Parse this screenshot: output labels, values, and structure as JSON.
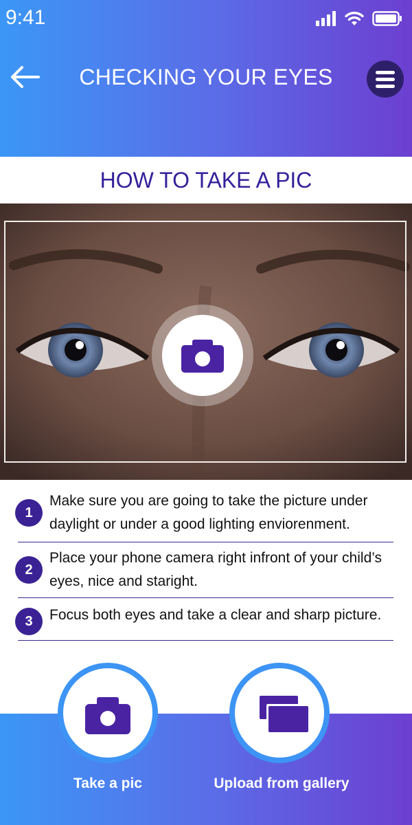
{
  "status_bar": {
    "time": "9:41"
  },
  "header": {
    "title": "CHECKING YOUR EYES"
  },
  "section": {
    "heading": "HOW TO TAKE A PIC"
  },
  "steps": [
    {
      "number": "1",
      "text": "Make sure you are going to take the picture under daylight or under a good lighting enviorenment."
    },
    {
      "number": "2",
      "text": "Place your phone camera right infront of your child’s eyes, nice and staright."
    },
    {
      "number": "3",
      "text": "Focus both eyes and take a clear and sharp picture."
    }
  ],
  "actions": {
    "take_pic_label": "Take a pic",
    "gallery_label": "Upload from gallery"
  },
  "colors": {
    "gradient_start": "#3b97f6",
    "gradient_end": "#6c3fd0",
    "accent": "#3b2294",
    "menu_bg": "#2e1f6b"
  },
  "icons": [
    "back-arrow-icon",
    "menu-icon",
    "camera-icon",
    "gallery-icon",
    "signal-icon",
    "wifi-icon",
    "battery-icon"
  ]
}
